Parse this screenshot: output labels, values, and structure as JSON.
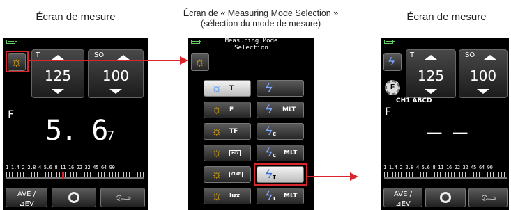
{
  "captions": {
    "left": "Écran de mesure",
    "center_line1": "Écran de « Measuring Mode Selection »",
    "center_line2": "(sélection du mode de mesure)",
    "right": "Écran de mesure"
  },
  "screen_left": {
    "mode_icon": "sun-icon",
    "t_label": "T",
    "t_value": "125",
    "iso_label": "ISO",
    "iso_value": "100",
    "f_label": "F",
    "f_value": "5. 6",
    "f_sub": "7",
    "scale": "1 1.4 2 2.8 4 5.6 8 11 16 22 32 45 64 90",
    "ave_line1": "AVE /",
    "ave_line2": "⊿EV"
  },
  "screen_mid": {
    "title_line1": "Measuring Mode",
    "title_line2": "Selection",
    "modes": [
      {
        "label": "T",
        "icon": "sun-icon"
      },
      {
        "label": "",
        "icon": "bolt-icon"
      },
      {
        "label": "F",
        "icon": "sun-icon"
      },
      {
        "label": "MLT",
        "icon": "bolt-icon"
      },
      {
        "label": "TF",
        "icon": "sun-icon"
      },
      {
        "label": "",
        "sub": "C",
        "icon": "bolt-icon"
      },
      {
        "label": "",
        "icon": "sun-hd-icon"
      },
      {
        "label": "MLT",
        "sub": "C",
        "icon": "bolt-icon"
      },
      {
        "label": "",
        "icon": "sun-cine-icon"
      },
      {
        "label": "",
        "sub": "T",
        "icon": "bolt-icon"
      },
      {
        "label": "lux",
        "icon": "sun-icon"
      },
      {
        "label": "MLT",
        "sub": "T",
        "icon": "bolt-icon"
      }
    ]
  },
  "screen_right": {
    "t_label": "T",
    "t_value": "125",
    "iso_label": "ISO",
    "iso_value": "100",
    "channel": "CH1  ABCD",
    "f_label": "F",
    "f_value": "— —",
    "scale": "1 1.4 2 2.8 4 5.6 8 11 16 22 32 45 64 90",
    "ave_line1": "AVE /",
    "ave_line2": "⊿EV"
  },
  "colors": {
    "accent_red": "#d9262c",
    "sun": "#f0b400",
    "bolt": "#7ea7ff"
  }
}
